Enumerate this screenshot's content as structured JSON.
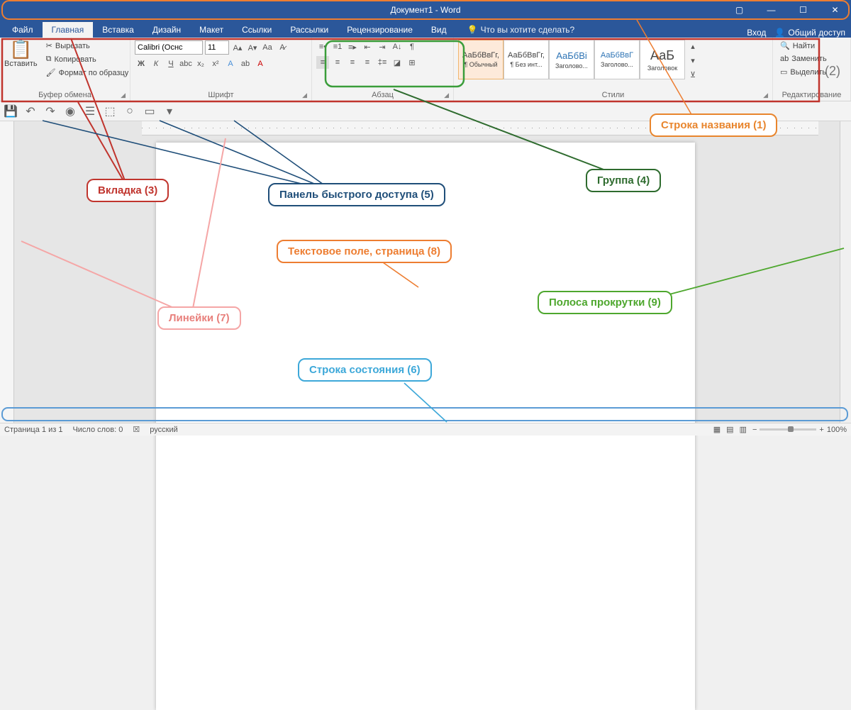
{
  "title": "Документ1 - Word",
  "tabs": [
    "Файл",
    "Главная",
    "Вставка",
    "Дизайн",
    "Макет",
    "Ссылки",
    "Рассылки",
    "Рецензирование",
    "Вид"
  ],
  "activeTab": 1,
  "tellme": "Что вы хотите сделать?",
  "signin": "Вход",
  "share": "Общий доступ",
  "clipboard": {
    "label": "Буфер обмена",
    "paste": "Вставить",
    "cut": "Вырезать",
    "copy": "Копировать",
    "format": "Формат по образцу"
  },
  "font": {
    "label": "Шрифт",
    "name": "Calibri (Оснс",
    "size": "11"
  },
  "para": {
    "label": "Абзац"
  },
  "styles": {
    "label": "Стили",
    "items": [
      {
        "prev": "АаБбВвГг,",
        "name": "¶ Обычный"
      },
      {
        "prev": "АаБбВвГг,",
        "name": "¶ Без инт..."
      },
      {
        "prev": "АаБбВі",
        "name": "Заголово..."
      },
      {
        "prev": "АаБбВвГ",
        "name": "Заголово..."
      },
      {
        "prev": "АаБ",
        "name": "Заголовок"
      }
    ]
  },
  "editing": {
    "label": "Редактирование",
    "find": "Найти",
    "replace": "Заменить",
    "select": "Выделить"
  },
  "status": {
    "page": "Страница 1 из 1",
    "words": "Число слов: 0",
    "lang": "русский",
    "zoom": "100%"
  },
  "callouts": {
    "c1": "Строка названия (1)",
    "c2": "(2)",
    "c3": "Вкладка (3)",
    "c4": "Группа (4)",
    "c5": "Панель быстрого доступа (5)",
    "c6": "Строка состояния (6)",
    "c7": "Линейки (7)",
    "c8": "Текстовое поле, страница (8)",
    "c9": "Полоса прокрутки (9)"
  }
}
